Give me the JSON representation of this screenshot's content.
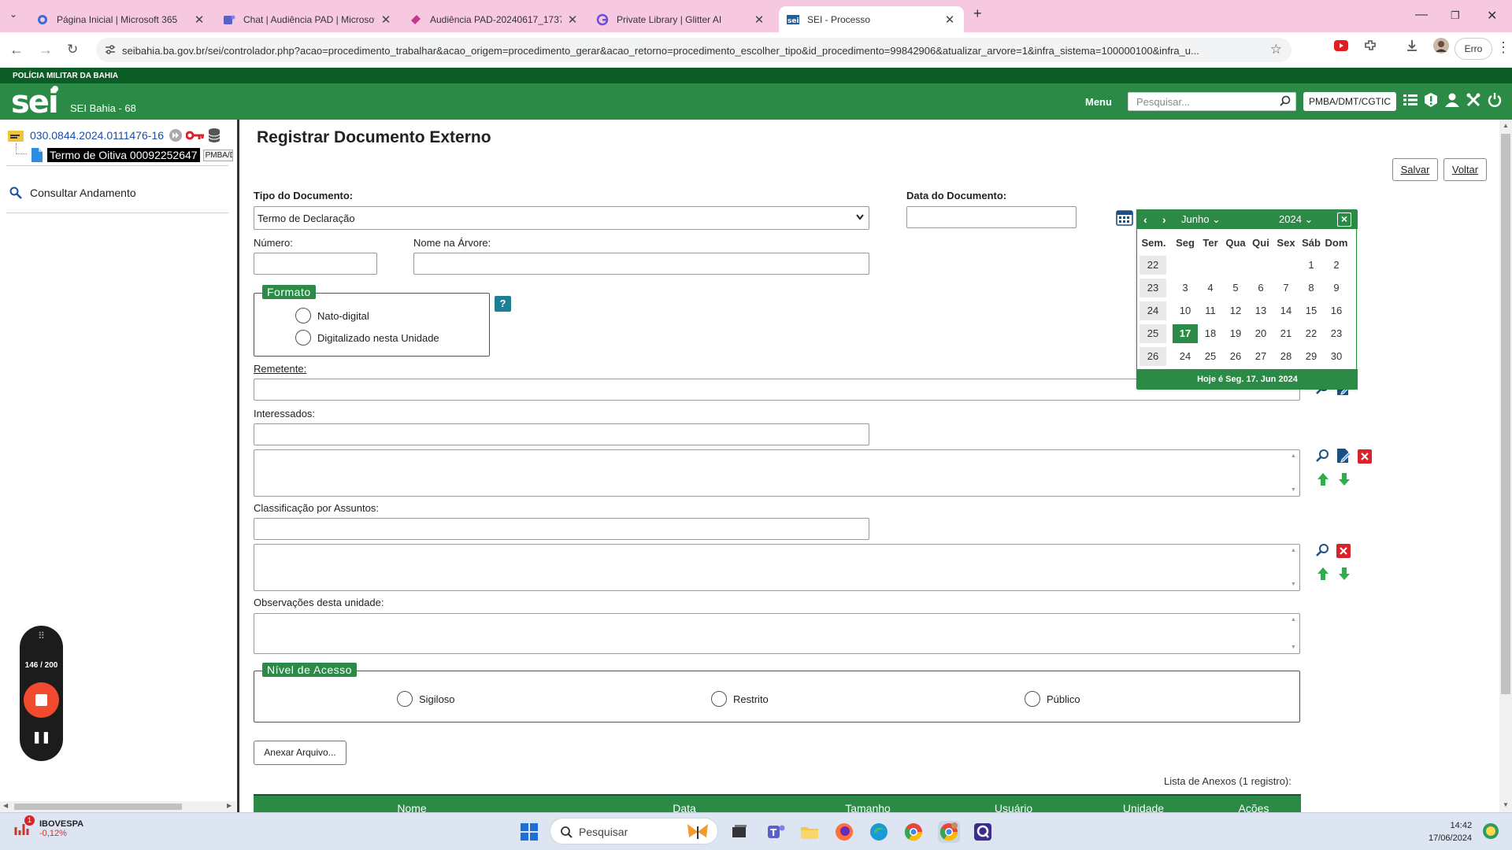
{
  "browser": {
    "tabs": [
      {
        "title": "Página Inicial | Microsoft 365",
        "icon": "microsoft365-icon",
        "active": false
      },
      {
        "title": "Chat | Audiência PAD | Microsoft",
        "icon": "teams-icon",
        "active": false
      },
      {
        "title": "Audiência PAD-20240617_1737",
        "icon": "clipchamp-icon",
        "active": false
      },
      {
        "title": "Private Library | Glitter AI",
        "icon": "glitter-icon",
        "active": false
      },
      {
        "title": "SEI - Processo",
        "icon": "sei-icon",
        "active": true
      }
    ],
    "url": "seibahia.ba.gov.br/sei/controlador.php?acao=procedimento_trabalhar&acao_origem=procedimento_gerar&acao_retorno=procedimento_escolher_tipo&id_procedimento=99842906&atualizar_arvore=1&infra_sistema=100000100&infra_u...",
    "profile_button": "Erro",
    "new_tab": "+"
  },
  "sei": {
    "org": "POLÍCIA MILITAR DA BAHIA",
    "logo": "sei",
    "system_label": "SEI Bahia - 68",
    "menu_label": "Menu",
    "search_placeholder": "Pesquisar...",
    "unit": "PMBA/DMT/CGTIC"
  },
  "tree": {
    "process_number": "030.0844.2024.0111476-16",
    "document_label": "Termo de Oitiva 00092252647",
    "document_unit": "PMBA/DMT",
    "consult": "Consultar Andamento"
  },
  "recorder": {
    "count": "146 / 200"
  },
  "form": {
    "title": "Registrar Documento Externo",
    "save": "Salvar",
    "back": "Voltar",
    "tipo_label": "Tipo do Documento:",
    "tipo_value": "Termo de Declaração",
    "data_label": "Data do Documento:",
    "numero_label": "Número:",
    "nome_arvore_label": "Nome na Árvore:",
    "formato_legend": "Formato",
    "formato_options": [
      "Nato-digital",
      "Digitalizado nesta Unidade"
    ],
    "help": "?",
    "remetente_label": "Remetente:",
    "interessados_label": "Interessados:",
    "classificacao_label": "Classificação por Assuntos:",
    "observacoes_label": "Observações desta unidade:",
    "nivel_legend": "Nível de Acesso",
    "nivel_options": [
      "Sigiloso",
      "Restrito",
      "Público"
    ],
    "anexar": "Anexar Arquivo...",
    "lista_anexos": "Lista de Anexos (1 registro):",
    "anexos_columns": [
      "Nome",
      "Data",
      "Tamanho",
      "Usuário",
      "Unidade",
      "Ações"
    ]
  },
  "calendar": {
    "month": "Junho",
    "year": "2024",
    "weekday_headers": [
      "Sem.",
      "Seg",
      "Ter",
      "Qua",
      "Qui",
      "Sex",
      "Sáb",
      "Dom"
    ],
    "weeks": [
      {
        "week": "22",
        "days": [
          "",
          "",
          "",
          "",
          "",
          "1",
          "2"
        ]
      },
      {
        "week": "23",
        "days": [
          "3",
          "4",
          "5",
          "6",
          "7",
          "8",
          "9"
        ]
      },
      {
        "week": "24",
        "days": [
          "10",
          "11",
          "12",
          "13",
          "14",
          "15",
          "16"
        ]
      },
      {
        "week": "25",
        "days": [
          "17",
          "18",
          "19",
          "20",
          "21",
          "22",
          "23"
        ]
      },
      {
        "week": "26",
        "days": [
          "24",
          "25",
          "26",
          "27",
          "28",
          "29",
          "30"
        ]
      }
    ],
    "selected_day": "17",
    "today_text": "Hoje é Seg. 17. Jun 2024"
  },
  "taskbar": {
    "stock_name": "IBOVESPA",
    "stock_change": "-0,12%",
    "stock_badge": "1",
    "search_placeholder": "Pesquisar",
    "time": "14:42",
    "date": "17/06/2024"
  },
  "colors": {
    "sei_green": "#2c8a47",
    "sei_dark_green": "#0c5c26",
    "tab_bar": "#f7c9e0"
  }
}
